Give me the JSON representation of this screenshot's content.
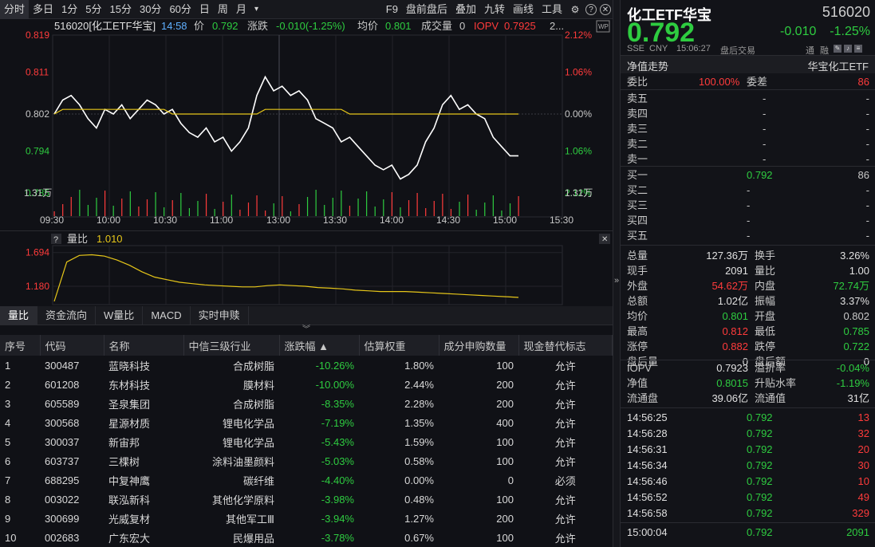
{
  "toolbar": {
    "periods": [
      "分时",
      "多日",
      "1分",
      "5分",
      "15分",
      "30分",
      "60分",
      "日",
      "周",
      "月"
    ],
    "more": "▾",
    "right_items": [
      "F9",
      "盘前盘后",
      "叠加",
      "九转",
      "画线",
      "工具"
    ],
    "icons": [
      "gear-icon",
      "help-icon",
      "close-icon"
    ]
  },
  "chart_header": {
    "name": "516020[化工ETF华宝]",
    "time": "14:58",
    "price_label": "价",
    "price": "0.792",
    "change_label": "涨跌",
    "change": "-0.010(-1.25%)",
    "avg_label": "均价",
    "avg": "0.801",
    "vol_label": "成交量",
    "vol": "0",
    "iopv_label": "IOPV",
    "iopv": "0.7925",
    "extra": "2...",
    "wp_badge": "WP"
  },
  "chart_data": [
    {
      "type": "line",
      "title": "516020[化工ETF华宝]",
      "x_ticks": [
        "09:30",
        "10:00",
        "10:30",
        "11:00",
        "13:00",
        "13:30",
        "14:00",
        "14:30",
        "15:00",
        "15:30"
      ],
      "y_ticks_left": [
        "0.819",
        "0.811",
        "0.802",
        "0.794",
        "0.785"
      ],
      "y_ticks_right": [
        "2.12%",
        "1.06%",
        "0.00%",
        "1.06%",
        "2.12%"
      ],
      "ylim": [
        0.785,
        0.819
      ],
      "vol_tick_left": "1.31万",
      "vol_tick_right": "1.31万",
      "series": [
        {
          "name": "价",
          "color": "#ffffff",
          "values": [
            0.802,
            0.805,
            0.806,
            0.804,
            0.801,
            0.799,
            0.803,
            0.802,
            0.804,
            0.801,
            0.803,
            0.805,
            0.804,
            0.802,
            0.803,
            0.8,
            0.798,
            0.797,
            0.799,
            0.796,
            0.797,
            0.794,
            0.796,
            0.799,
            0.806,
            0.81,
            0.807,
            0.808,
            0.806,
            0.807,
            0.805,
            0.801,
            0.8,
            0.799,
            0.796,
            0.797,
            0.795,
            0.793,
            0.791,
            0.79,
            0.791,
            0.788,
            0.789,
            0.791,
            0.796,
            0.799,
            0.804,
            0.806,
            0.803,
            0.804,
            0.802,
            0.801,
            0.797,
            0.795,
            0.793,
            0.793
          ]
        },
        {
          "name": "均价",
          "color": "#e6c619",
          "values": [
            0.802,
            0.803,
            0.803,
            0.803,
            0.803,
            0.803,
            0.803,
            0.803,
            0.803,
            0.803,
            0.803,
            0.803,
            0.803,
            0.803,
            0.802,
            0.802,
            0.802,
            0.802,
            0.802,
            0.802,
            0.802,
            0.802,
            0.802,
            0.802,
            0.802,
            0.803,
            0.803,
            0.803,
            0.803,
            0.803,
            0.803,
            0.803,
            0.803,
            0.803,
            0.803,
            0.802,
            0.802,
            0.802,
            0.802,
            0.802,
            0.802,
            0.802,
            0.802,
            0.802,
            0.802,
            0.802,
            0.802,
            0.802,
            0.802,
            0.802,
            0.802,
            0.802,
            0.802,
            0.802,
            0.802,
            0.802
          ]
        }
      ]
    },
    {
      "type": "line",
      "title": "量比",
      "value_label": "1.010",
      "y_ticks": [
        "1.694",
        "1.180"
      ],
      "ylim": [
        0.9,
        1.8
      ],
      "series": [
        {
          "name": "量比",
          "color": "#e6c619",
          "values": [
            0.95,
            1.55,
            1.65,
            1.66,
            1.64,
            1.58,
            1.5,
            1.4,
            1.32,
            1.28,
            1.24,
            1.22,
            1.2,
            1.19,
            1.18,
            1.17,
            1.17,
            1.19,
            1.2,
            1.19,
            1.18,
            1.16,
            1.15,
            1.14,
            1.12,
            1.11,
            1.1,
            1.1,
            1.1,
            1.09,
            1.08,
            1.07,
            1.06,
            1.05,
            1.04,
            1.03,
            1.02,
            1.01
          ]
        }
      ]
    }
  ],
  "lower_tabs": [
    "量比",
    "资金流向",
    "W量比",
    "MACD",
    "实时申赎"
  ],
  "holdings": {
    "headers": [
      "序号",
      "代码",
      "名称",
      "中信三级行业",
      "涨跌幅 ▲",
      "估算权重",
      "成分申购数量",
      "现金替代标志"
    ],
    "rows": [
      [
        "1",
        "300487",
        "蓝晓科技",
        "合成树脂",
        "-10.26%",
        "1.80%",
        "100",
        "允许"
      ],
      [
        "2",
        "601208",
        "东材科技",
        "膜材料",
        "-10.00%",
        "2.44%",
        "200",
        "允许"
      ],
      [
        "3",
        "605589",
        "圣泉集团",
        "合成树脂",
        "-8.35%",
        "2.28%",
        "200",
        "允许"
      ],
      [
        "4",
        "300568",
        "星源材质",
        "锂电化学品",
        "-7.19%",
        "1.35%",
        "400",
        "允许"
      ],
      [
        "5",
        "300037",
        "新宙邦",
        "锂电化学品",
        "-5.43%",
        "1.59%",
        "100",
        "允许"
      ],
      [
        "6",
        "603737",
        "三棵树",
        "涂料油墨颜料",
        "-5.03%",
        "0.58%",
        "100",
        "允许"
      ],
      [
        "7",
        "688295",
        "中复神鹰",
        "碳纤维",
        "-4.40%",
        "0.00%",
        "0",
        "必须"
      ],
      [
        "8",
        "003022",
        "联泓新科",
        "其他化学原料",
        "-3.98%",
        "0.48%",
        "100",
        "允许"
      ],
      [
        "9",
        "300699",
        "光威复材",
        "其他军工Ⅲ",
        "-3.94%",
        "1.27%",
        "200",
        "允许"
      ],
      [
        "10",
        "002683",
        "广东宏大",
        "民爆用品",
        "-3.78%",
        "0.67%",
        "100",
        "允许"
      ]
    ]
  },
  "quote": {
    "name": "化工ETF华宝",
    "code": "516020",
    "price": "0.792",
    "change": "-0.010",
    "pct": "-1.25%",
    "exchange": "SSE",
    "currency": "CNY",
    "time": "15:06:27",
    "session": "盘后交易",
    "badges": [
      "通",
      "融"
    ],
    "nav_label": "净值走势",
    "nav_name": "华宝化工ETF",
    "weibi_label": "委比",
    "weibi": "100.00%",
    "weicha_label": "委差",
    "weicha": "86",
    "asks": [
      [
        "卖五",
        "-",
        "-"
      ],
      [
        "卖四",
        "-",
        "-"
      ],
      [
        "卖三",
        "-",
        "-"
      ],
      [
        "卖二",
        "-",
        "-"
      ],
      [
        "卖一",
        "-",
        "-"
      ]
    ],
    "bids": [
      [
        "买一",
        "0.792",
        "86"
      ],
      [
        "买二",
        "-",
        "-"
      ],
      [
        "买三",
        "-",
        "-"
      ],
      [
        "买四",
        "-",
        "-"
      ],
      [
        "买五",
        "-",
        "-"
      ]
    ],
    "stats": [
      [
        "总量",
        "127.36万",
        "换手",
        "3.26%"
      ],
      [
        "现手",
        "2091",
        "量比",
        "1.00"
      ],
      [
        "外盘",
        "54.62万",
        "内盘",
        "72.74万"
      ],
      [
        "总额",
        "1.02亿",
        "振幅",
        "3.37%"
      ],
      [
        "均价",
        "0.801",
        "开盘",
        "0.802"
      ],
      [
        "最高",
        "0.812",
        "最低",
        "0.785"
      ],
      [
        "涨停",
        "0.882",
        "跌停",
        "0.722"
      ],
      [
        "盘后量",
        "0",
        "盘后额",
        "0"
      ]
    ],
    "iopv_stats": [
      [
        "IOPV",
        "0.7923",
        "溢折率",
        "-0.04%"
      ],
      [
        "净值",
        "0.8015",
        "升贴水率",
        "-1.19%"
      ],
      [
        "流通盘",
        "39.06亿",
        "流通值",
        "31亿"
      ]
    ],
    "ticks": [
      [
        "14:56:25",
        "0.792",
        "13"
      ],
      [
        "14:56:28",
        "0.792",
        "32"
      ],
      [
        "14:56:31",
        "0.792",
        "20"
      ],
      [
        "14:56:34",
        "0.792",
        "30"
      ],
      [
        "14:56:46",
        "0.792",
        "10"
      ],
      [
        "14:56:52",
        "0.792",
        "49"
      ],
      [
        "14:56:58",
        "0.792",
        "329"
      ],
      [
        "15:00:04",
        "0.792",
        "2091"
      ]
    ]
  },
  "sub_chart": {
    "help": "?",
    "label": "量比",
    "value": "1.010"
  },
  "colors": {
    "up": "#ff3b3b",
    "down": "#2ecc40",
    "avg": "#e6c619",
    "price": "#ffffff",
    "bg": "#101116"
  }
}
